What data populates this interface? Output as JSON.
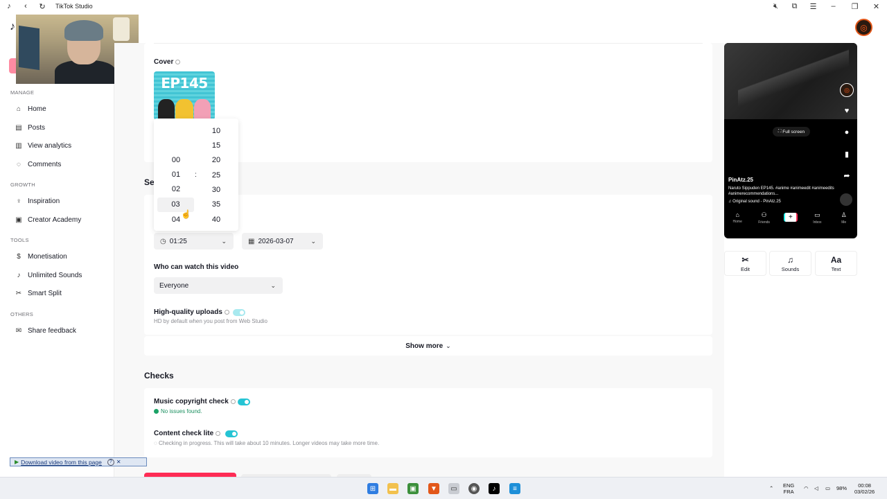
{
  "titlebar": {
    "title": "TikTok Studio"
  },
  "sidebar": {
    "sections": [
      {
        "label": "MANAGE",
        "items": [
          {
            "label": "Home",
            "icon": "home-icon"
          },
          {
            "label": "Posts",
            "icon": "posts-icon"
          },
          {
            "label": "View analytics",
            "icon": "analytics-icon"
          },
          {
            "label": "Comments",
            "icon": "comments-icon"
          }
        ]
      },
      {
        "label": "GROWTH",
        "items": [
          {
            "label": "Inspiration",
            "icon": "bulb-icon"
          },
          {
            "label": "Creator Academy",
            "icon": "academy-icon"
          }
        ]
      },
      {
        "label": "TOOLS",
        "items": [
          {
            "label": "Monetisation",
            "icon": "dollar-icon"
          },
          {
            "label": "Unlimited Sounds",
            "icon": "music-icon"
          },
          {
            "label": "Smart Split",
            "icon": "scissors-icon"
          }
        ]
      },
      {
        "label": "OTHERS",
        "items": [
          {
            "label": "Share feedback",
            "icon": "feedback-icon"
          }
        ]
      }
    ]
  },
  "cover": {
    "label": "Cover",
    "thumb_text": "EP145"
  },
  "settings": {
    "title_partial": "Se"
  },
  "time_picker": {
    "hours": [
      "00",
      "01",
      "02",
      "03",
      "04"
    ],
    "minutes": [
      "10",
      "15",
      "20",
      "25",
      "30",
      "35",
      "40"
    ],
    "separator": ":",
    "hovered_hour": "03"
  },
  "schedule": {
    "time_value": "01:25",
    "date_value": "2026-03-07"
  },
  "visibility": {
    "label": "Who can watch this video",
    "value": "Everyone"
  },
  "hq_upload": {
    "label": "High-quality uploads",
    "hint": "HD by default when you post from Web Studio"
  },
  "show_more": {
    "label": "Show more"
  },
  "checks": {
    "title": "Checks",
    "music": {
      "label": "Music copyright check",
      "status": "No issues found."
    },
    "content": {
      "label": "Content check lite",
      "status": "Checking in progress. This will take about 10 minutes. Longer videos may take more time."
    }
  },
  "preview": {
    "fullscreen_label": "Full screen",
    "username": "PinAtz.25",
    "caption": "Naruto Sippuden EP145. #anime #animeedit #animeedits #animerecommendations...",
    "sound": "Original sound - PinAtz.25",
    "nav": [
      "Home",
      "Friends",
      "",
      "Inbox",
      "Me"
    ]
  },
  "tools": [
    {
      "label": "Edit",
      "icon": "scissors-icon",
      "glyph": "✂"
    },
    {
      "label": "Sounds",
      "icon": "music-note-icon",
      "glyph": "♫"
    },
    {
      "label": "Text",
      "icon": "text-icon",
      "glyph": "Aa"
    }
  ],
  "download_bar": {
    "label": "Download video from this page"
  },
  "taskbar": {
    "lang_top": "ENG",
    "lang_bottom": "FRA",
    "battery": "98%",
    "time": "00:08",
    "date": "03/02/26"
  },
  "colors": {
    "accent": "#fe2c55",
    "toggle": "#25c4d4",
    "success": "#1ba266"
  }
}
